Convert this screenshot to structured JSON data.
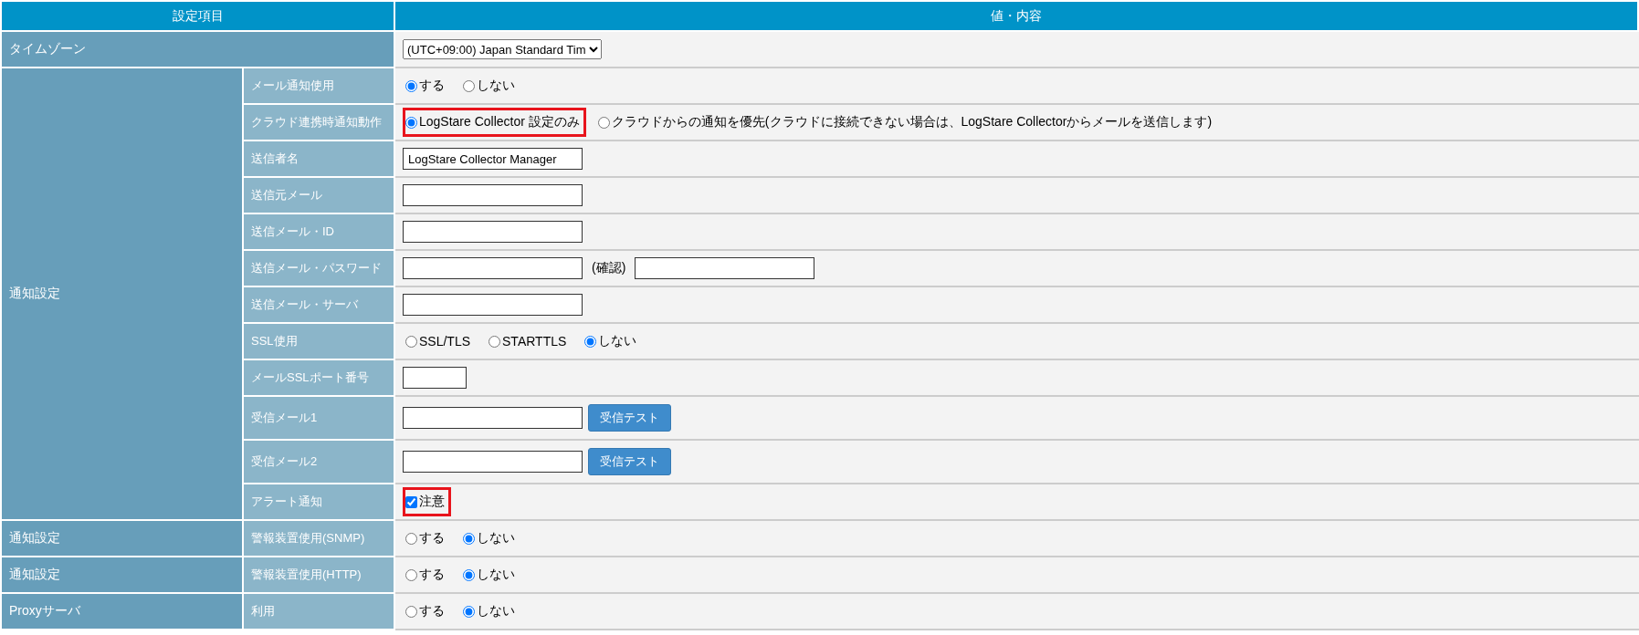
{
  "header": [
    "設定項目",
    "値・内容"
  ],
  "rows": [
    {
      "kind": "wide",
      "label": "タイムゾーン",
      "controls": [
        {
          "kind": "select",
          "value": "(UTC+09:00) Japan Standard Tim"
        }
      ]
    },
    {
      "kind": "group",
      "label": "通知設定",
      "children": [
        {
          "label": "メール通知使用",
          "controls": [
            {
              "kind": "radio",
              "label": "する",
              "selected": true
            },
            {
              "kind": "radio",
              "label": "しない",
              "selected": false
            }
          ]
        },
        {
          "label": "クラウド連携時通知動作",
          "controls": [
            {
              "kind": "radio",
              "label": "LogStare Collector 設定のみ",
              "selected": true,
              "highlighted": true
            },
            {
              "kind": "radio",
              "label": "クラウドからの通知を優先(クラウドに接続できない場合は、LogStare Collectorからメールを送信します)",
              "selected": false,
              "highlighted": false
            }
          ]
        },
        {
          "label": "送信者名",
          "controls": [
            {
              "kind": "text",
              "value": "LogStare Collector Manager"
            }
          ]
        },
        {
          "label": "送信元メール",
          "controls": [
            {
              "kind": "text"
            }
          ]
        },
        {
          "label": "送信メール・ID",
          "controls": [
            {
              "kind": "text"
            }
          ]
        },
        {
          "label": "送信メール・パスワード",
          "controls": [
            {
              "kind": "text"
            },
            {
              "kind": "note",
              "label": "(確認)"
            },
            {
              "kind": "text"
            }
          ]
        },
        {
          "label": "送信メール・サーバ",
          "controls": [
            {
              "kind": "text"
            }
          ]
        },
        {
          "label": "SSL使用",
          "controls": [
            {
              "kind": "radio",
              "label": "SSL/TLS",
              "selected": false
            },
            {
              "kind": "radio",
              "label": "STARTTLS",
              "selected": false
            },
            {
              "kind": "radio",
              "label": "しない",
              "selected": true
            }
          ]
        },
        {
          "label": "メールSSLポート番号",
          "controls": [
            {
              "kind": "short"
            }
          ]
        },
        {
          "label": "受信メール1",
          "controls": [
            {
              "kind": "text"
            },
            {
              "kind": "button",
              "label": "受信テスト"
            }
          ]
        },
        {
          "label": "受信メール2",
          "controls": [
            {
              "kind": "text"
            },
            {
              "kind": "button",
              "label": "受信テスト"
            }
          ]
        },
        {
          "label": "アラート通知",
          "controls": [
            {
              "kind": "checkbox",
              "label": "注意",
              "checked": true,
              "highlighted": true
            }
          ]
        }
      ]
    },
    {
      "kind": "single",
      "group": "通知設定",
      "label": "警報装置使用(SNMP)",
      "controls": [
        {
          "kind": "radio",
          "label": "する",
          "selected": false
        },
        {
          "kind": "radio",
          "label": "しない",
          "selected": true
        }
      ]
    },
    {
      "kind": "single",
      "group": "通知設定",
      "label": "警報装置使用(HTTP)",
      "controls": [
        {
          "kind": "radio",
          "label": "する",
          "selected": false
        },
        {
          "kind": "radio",
          "label": "しない",
          "selected": true
        }
      ]
    },
    {
      "kind": "single",
      "group": "Proxyサーバ",
      "label": "利用",
      "controls": [
        {
          "kind": "radio",
          "label": "する",
          "selected": false
        },
        {
          "kind": "radio",
          "label": "しない",
          "selected": true
        }
      ]
    }
  ]
}
